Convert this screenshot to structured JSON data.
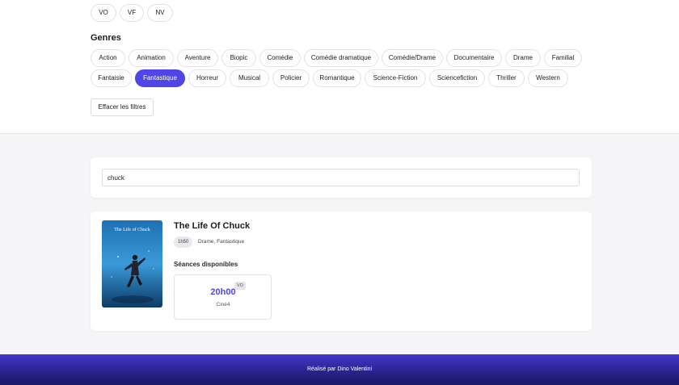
{
  "languages": [
    {
      "label": "VO",
      "active": true
    },
    {
      "label": "VF",
      "active": false
    },
    {
      "label": "NV",
      "active": false
    }
  ],
  "genres_title": "Genres",
  "genres_row1": [
    "Action",
    "Animation",
    "Aventure",
    "Biopic",
    "Comédie",
    "Comédie dramatique",
    "Comédie/Drame",
    "Documentaire",
    "Drame",
    "Familial"
  ],
  "genres_row2": [
    "Fantaisie",
    "Fantastique",
    "Horreur",
    "Musical",
    "Policier",
    "Romantique",
    "Science-Fiction",
    "Sciencefiction",
    "Thriller",
    "Western"
  ],
  "active_genre": "Fantastique",
  "clear_filters_label": "Effacer les filtres",
  "search": {
    "value": "chuck"
  },
  "movie": {
    "title": "The Life Of Chuck",
    "duration": "1h50",
    "genres": "Drame, Fantastique",
    "poster_title": "The Life of Chuck",
    "seances_title": "Séances disponibles",
    "seances": [
      {
        "time": "20h00",
        "version": "VO",
        "room": "Ciné4"
      }
    ]
  },
  "colors": {
    "accent": "#4f46e5",
    "footer_dark": "#1b1762"
  },
  "footer": {
    "text": "Réalisé par Dino Valentini"
  }
}
